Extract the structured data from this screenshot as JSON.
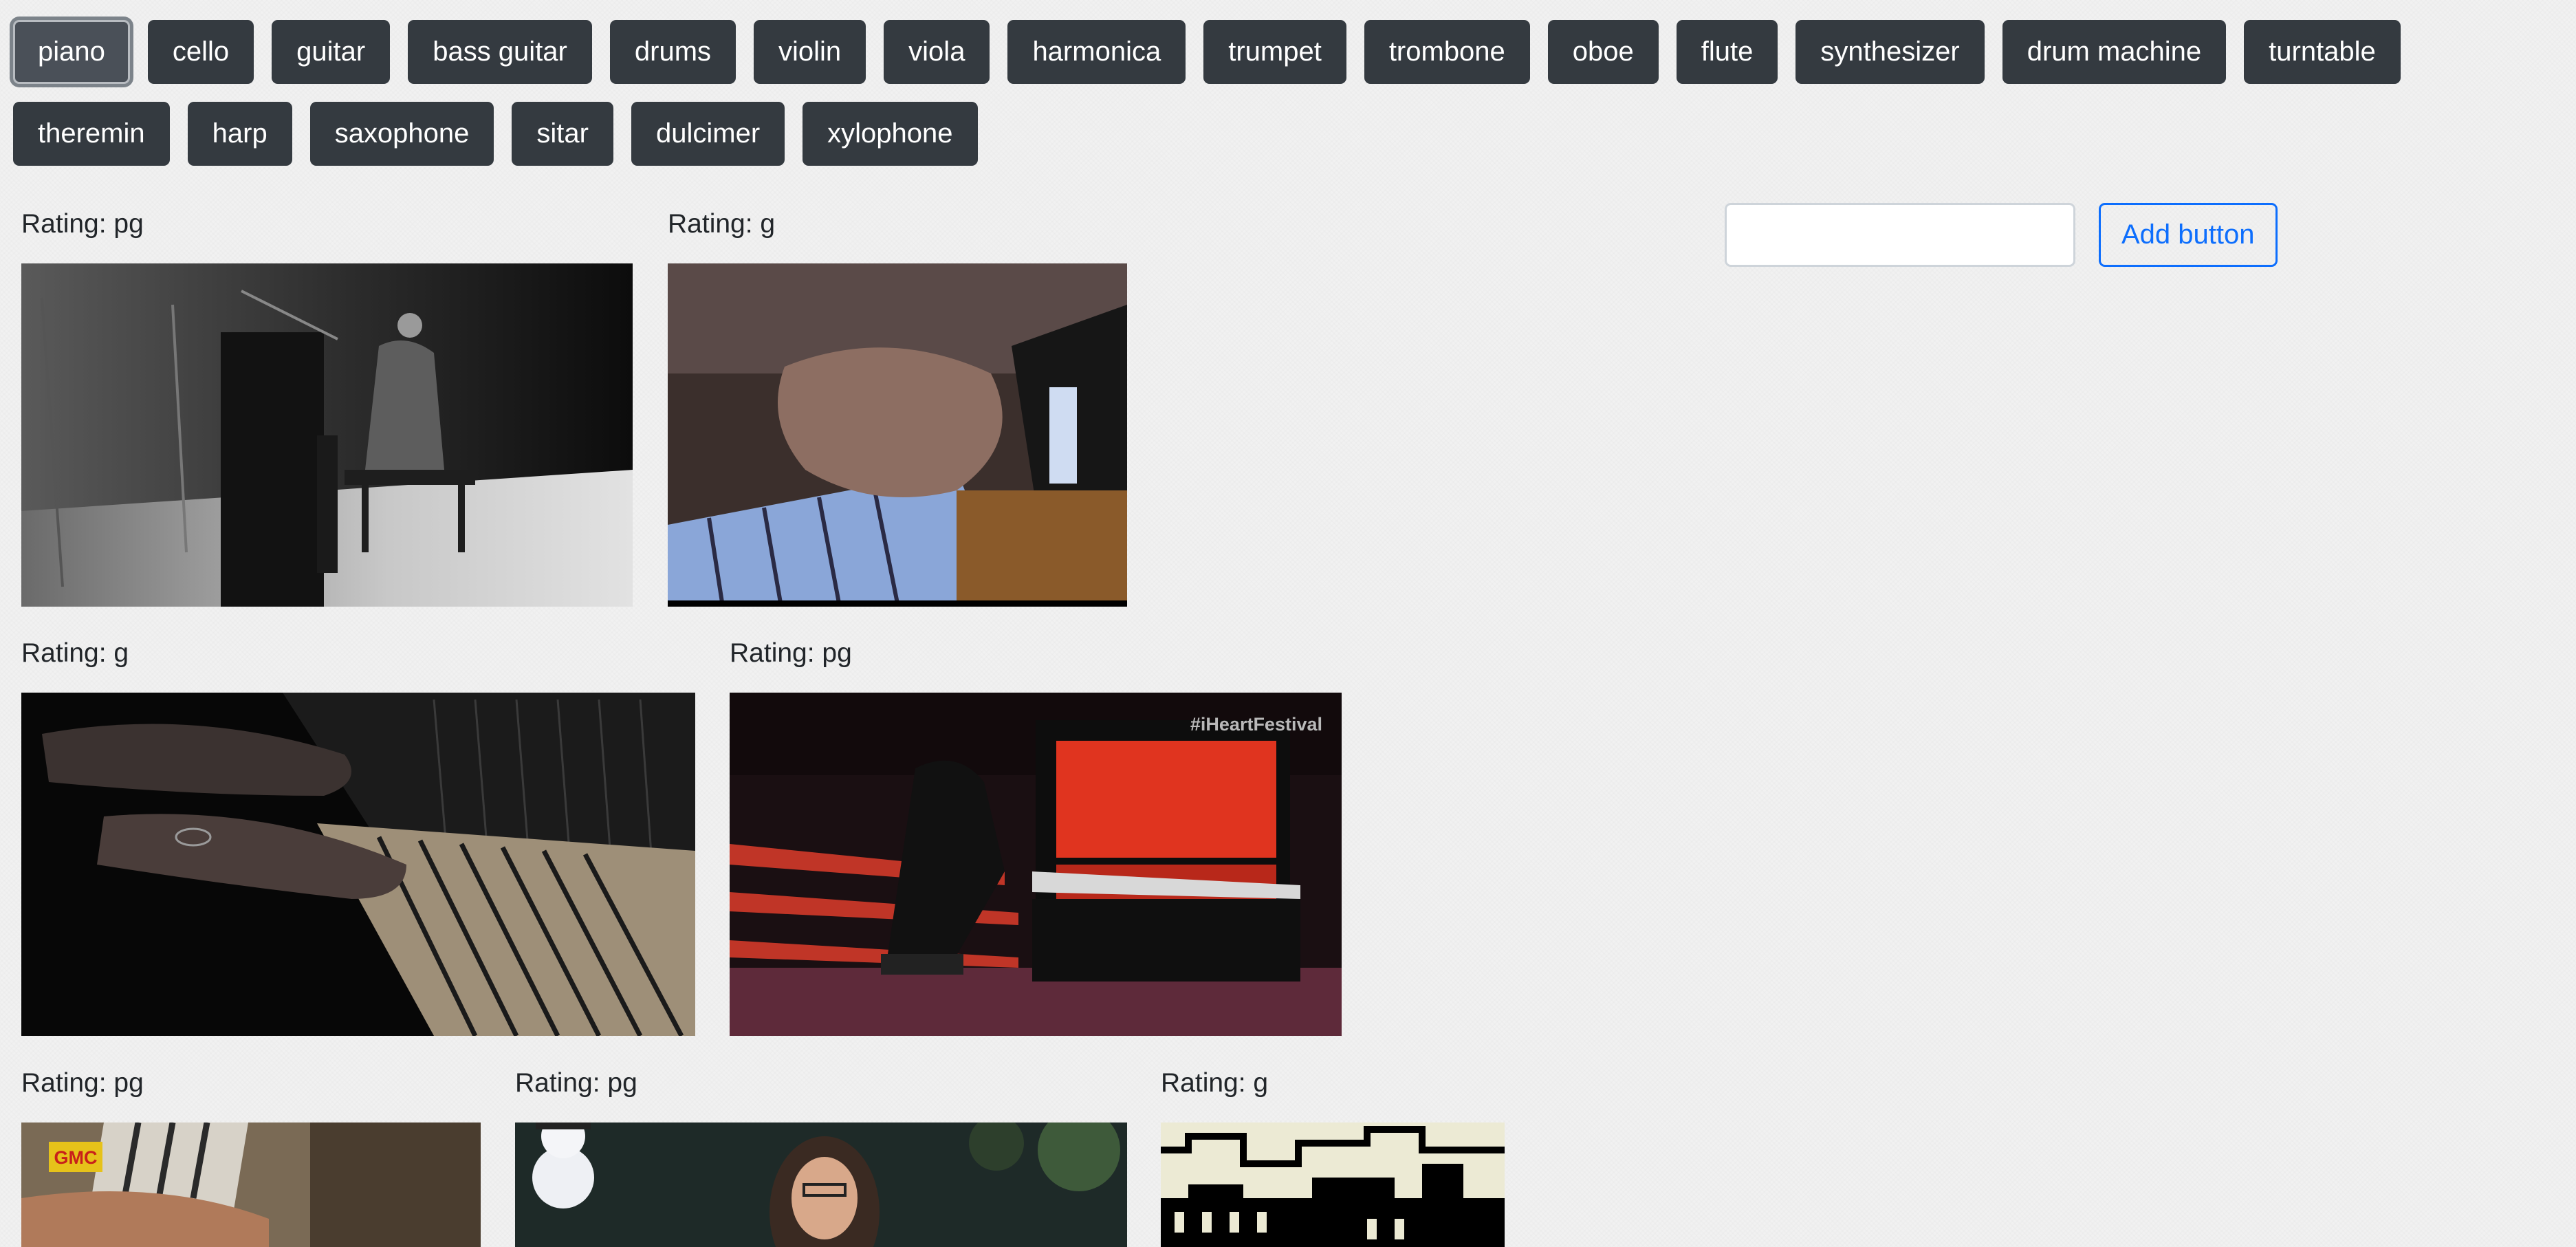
{
  "topics": [
    {
      "label": "piano",
      "active": true
    },
    {
      "label": "cello"
    },
    {
      "label": "guitar"
    },
    {
      "label": "bass guitar"
    },
    {
      "label": "drums"
    },
    {
      "label": "violin"
    },
    {
      "label": "viola"
    },
    {
      "label": "harmonica"
    },
    {
      "label": "trumpet"
    },
    {
      "label": "trombone"
    },
    {
      "label": "oboe"
    },
    {
      "label": "flute"
    },
    {
      "label": "synthesizer"
    },
    {
      "label": "drum machine"
    },
    {
      "label": "turntable"
    },
    {
      "label": "theremin"
    },
    {
      "label": "harp"
    },
    {
      "label": "saxophone"
    },
    {
      "label": "sitar"
    },
    {
      "label": "dulcimer"
    },
    {
      "label": "xylophone"
    }
  ],
  "form": {
    "input_value": "",
    "input_placeholder": "",
    "add_button_label": "Add button"
  },
  "gifs": [
    {
      "rating": "Rating: pg"
    },
    {
      "rating": "Rating: g"
    },
    {
      "rating": "Rating: g"
    },
    {
      "rating": "Rating: pg"
    },
    {
      "rating": "Rating: pg"
    },
    {
      "rating": "Rating: pg"
    },
    {
      "rating": "Rating: g"
    }
  ],
  "thumbnail_texts": {
    "festival_watermark": "#iHeartFestival",
    "channel_logo": "GMC"
  },
  "colors": {
    "topic_button_bg": "#343a40",
    "topic_button_text": "#ffffff",
    "add_button_accent": "#0d6efd",
    "page_bg": "#f1f1f1"
  }
}
